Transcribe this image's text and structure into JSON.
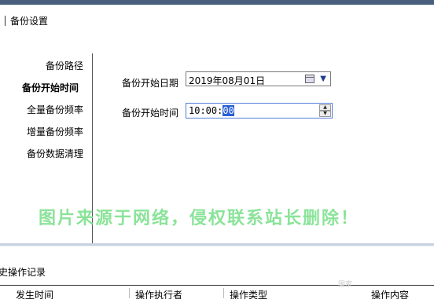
{
  "section_title": "备份设置",
  "nav": {
    "items": [
      {
        "label": "备份路径",
        "active": false
      },
      {
        "label": "备份开始时间",
        "active": true
      },
      {
        "label": "全量备份频率",
        "active": false
      },
      {
        "label": "增量备份频率",
        "active": false
      },
      {
        "label": "备份数据清理",
        "active": false
      }
    ]
  },
  "form": {
    "start_date_label": "备份开始日期",
    "start_date_value": "2019年08月01日",
    "start_time_label": "备份开始时间",
    "start_time_hm": "10:00:",
    "start_time_sec": "00"
  },
  "watermark": "图片来源于网络，侵权联系站长删除！",
  "log": {
    "title": "史操作记录",
    "columns": [
      "发生时间",
      "操作执行者",
      "操作类型",
      "操作内容"
    ]
  },
  "corner_mark": "国家 ..."
}
